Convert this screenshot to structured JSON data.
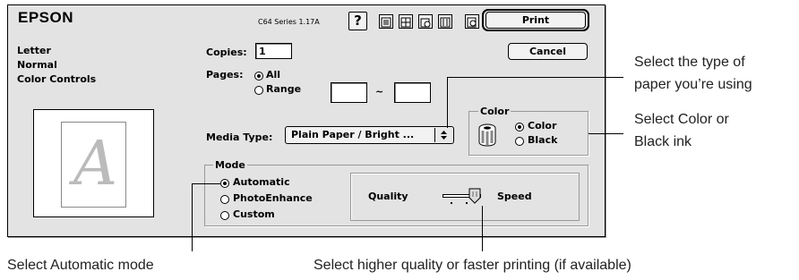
{
  "window": {
    "brand": "EPSON",
    "version": "C64 Series 1.17A",
    "help_glyph": "?"
  },
  "summary": {
    "line1": "Letter",
    "line2": "Normal",
    "line3": "Color Controls",
    "preview_letter": "A"
  },
  "toolbar_icons": [
    "help-icon",
    "paper-settings-icon",
    "layout-icon",
    "background-print-icon",
    "utility-icon",
    "preview-icon"
  ],
  "buttons": {
    "print": "Print",
    "cancel": "Cancel"
  },
  "copies": {
    "label": "Copies:",
    "value": "1"
  },
  "pages": {
    "label": "Pages:",
    "all": "All",
    "range": "Range",
    "tilde": "~",
    "from": "",
    "to": "",
    "selected": "All"
  },
  "media": {
    "label": "Media Type:",
    "value": "Plain Paper / Bright ..."
  },
  "color": {
    "legend": "Color",
    "options": [
      "Color",
      "Black"
    ],
    "selected": "Color"
  },
  "mode": {
    "legend": "Mode",
    "options": [
      "Automatic",
      "PhotoEnhance",
      "Custom"
    ],
    "selected": "Automatic"
  },
  "quality": {
    "left_label": "Quality",
    "right_label": "Speed",
    "level": 1.0
  },
  "annotations": {
    "paper_type_1": "Select the type of",
    "paper_type_2": "paper you’re using",
    "color_ink_1": "Select Color or",
    "color_ink_2": "Black ink",
    "automatic": "Select Automatic mode",
    "quality": "Select higher quality or faster printing (if available)"
  }
}
